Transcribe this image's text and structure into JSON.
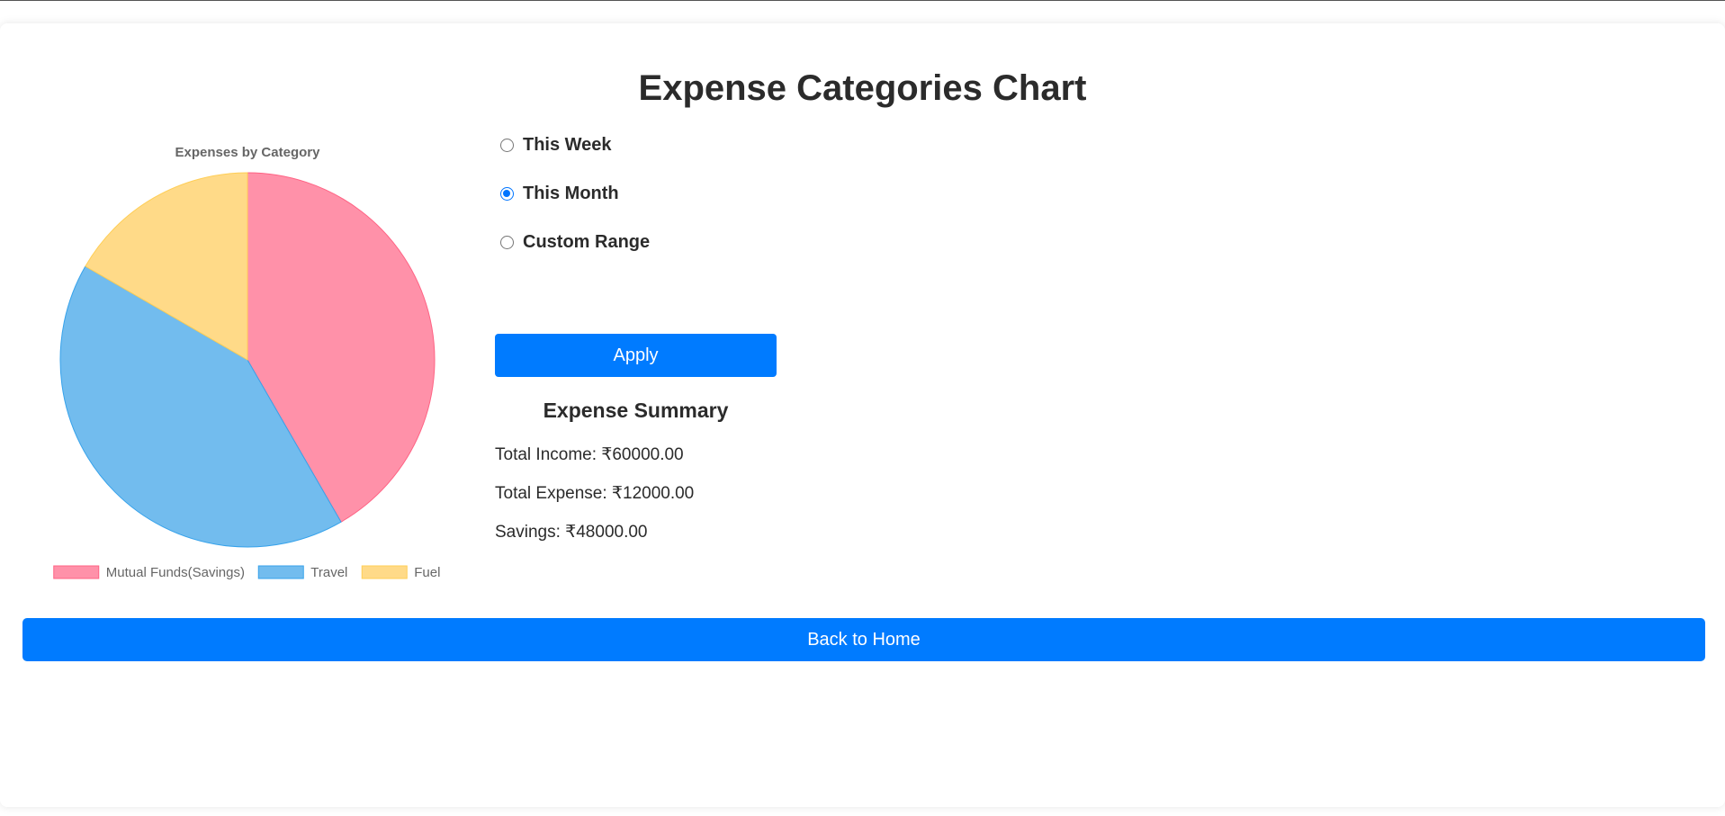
{
  "page": {
    "title": "Expense Categories Chart"
  },
  "filters": {
    "options": [
      {
        "label": "This Week",
        "checked": false
      },
      {
        "label": "This Month",
        "checked": true
      },
      {
        "label": "Custom Range",
        "checked": false
      }
    ],
    "apply_label": "Apply"
  },
  "summary": {
    "title": "Expense Summary",
    "total_income": "Total Income: ₹60000.00",
    "total_expense": "Total Expense: ₹12000.00",
    "savings": "Savings: ₹48000.00"
  },
  "back_label": "Back to Home",
  "colors": {
    "primary": "#007bff",
    "radio_checked": "#0075ff"
  },
  "chart_data": {
    "type": "pie",
    "title": "Expenses by Category",
    "categories": [
      "Mutual Funds(Savings)",
      "Travel",
      "Fuel"
    ],
    "values": [
      5000,
      5000,
      2000
    ],
    "colors": [
      "#ff91a9",
      "#72bcee",
      "#ffda88"
    ],
    "borders": [
      "#ff6384",
      "#36a2eb",
      "#ffce56"
    ],
    "legend_position": "bottom"
  }
}
